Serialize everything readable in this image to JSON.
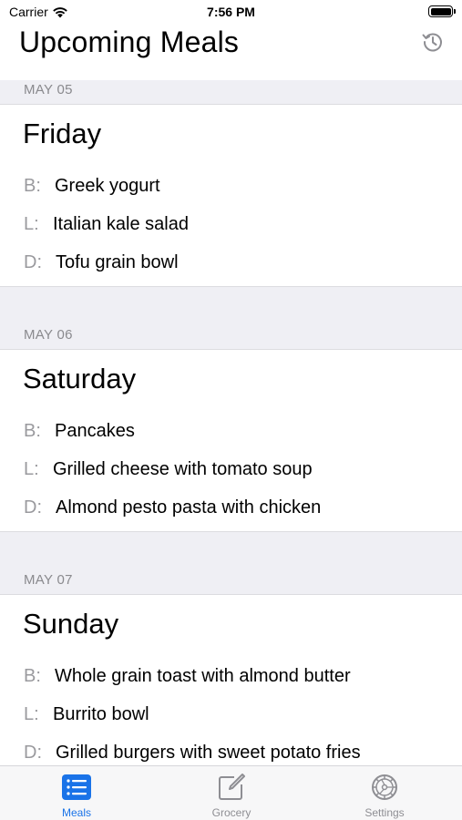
{
  "status": {
    "carrier": "Carrier",
    "time": "7:56 PM"
  },
  "header": {
    "title": "Upcoming Meals",
    "history_icon": "history-icon"
  },
  "days": [
    {
      "date": "MAY 05",
      "day": "Friday",
      "meals": [
        {
          "label": "B:",
          "name": "Greek yogurt"
        },
        {
          "label": "L:",
          "name": "Italian kale salad"
        },
        {
          "label": "D:",
          "name": "Tofu grain bowl"
        }
      ]
    },
    {
      "date": "MAY 06",
      "day": "Saturday",
      "meals": [
        {
          "label": "B:",
          "name": "Pancakes"
        },
        {
          "label": "L:",
          "name": "Grilled cheese with tomato soup"
        },
        {
          "label": "D:",
          "name": "Almond pesto pasta with chicken"
        }
      ]
    },
    {
      "date": "MAY 07",
      "day": "Sunday",
      "meals": [
        {
          "label": "B:",
          "name": "Whole grain toast with almond butter"
        },
        {
          "label": "L:",
          "name": "Burrito bowl"
        },
        {
          "label": "D:",
          "name": "Grilled burgers with sweet potato fries"
        }
      ]
    }
  ],
  "tabs": [
    {
      "label": "Meals",
      "icon": "list-icon",
      "active": true
    },
    {
      "label": "Grocery",
      "icon": "compose-icon",
      "active": false
    },
    {
      "label": "Settings",
      "icon": "gear-icon",
      "active": false
    }
  ],
  "colors": {
    "accent": "#1a73e8",
    "section_bg": "#efeff4",
    "muted": "#8e8e93"
  }
}
